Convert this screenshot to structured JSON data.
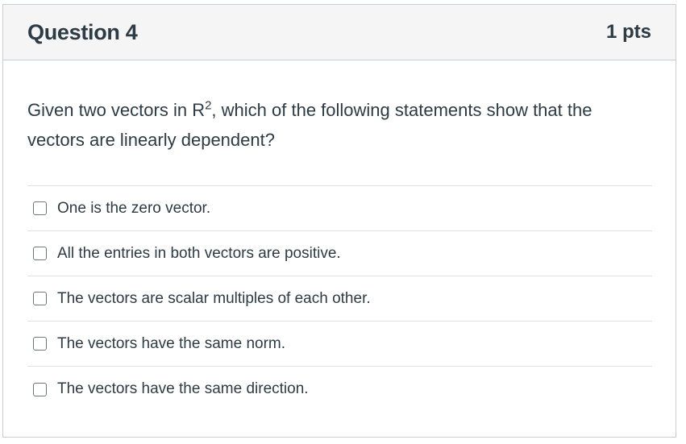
{
  "question": {
    "title": "Question 4",
    "points": "1 pts",
    "prompt_before": "Given two vectors in R",
    "prompt_sup": "2",
    "prompt_after": ", which of the following statements show that the vectors are linearly dependent?",
    "answers": [
      {
        "label": "One is the zero vector.",
        "checked": false
      },
      {
        "label": "All the entries in both vectors are positive.",
        "checked": false
      },
      {
        "label": "The vectors are scalar multiples of each other.",
        "checked": false
      },
      {
        "label": "The vectors have the same norm.",
        "checked": false
      },
      {
        "label": "The vectors have the same direction.",
        "checked": false
      }
    ]
  },
  "colors": {
    "text": "#2d3b45",
    "header_bg": "#f5f5f5",
    "border": "#c7cdd1",
    "divider": "#dfe3e6"
  }
}
